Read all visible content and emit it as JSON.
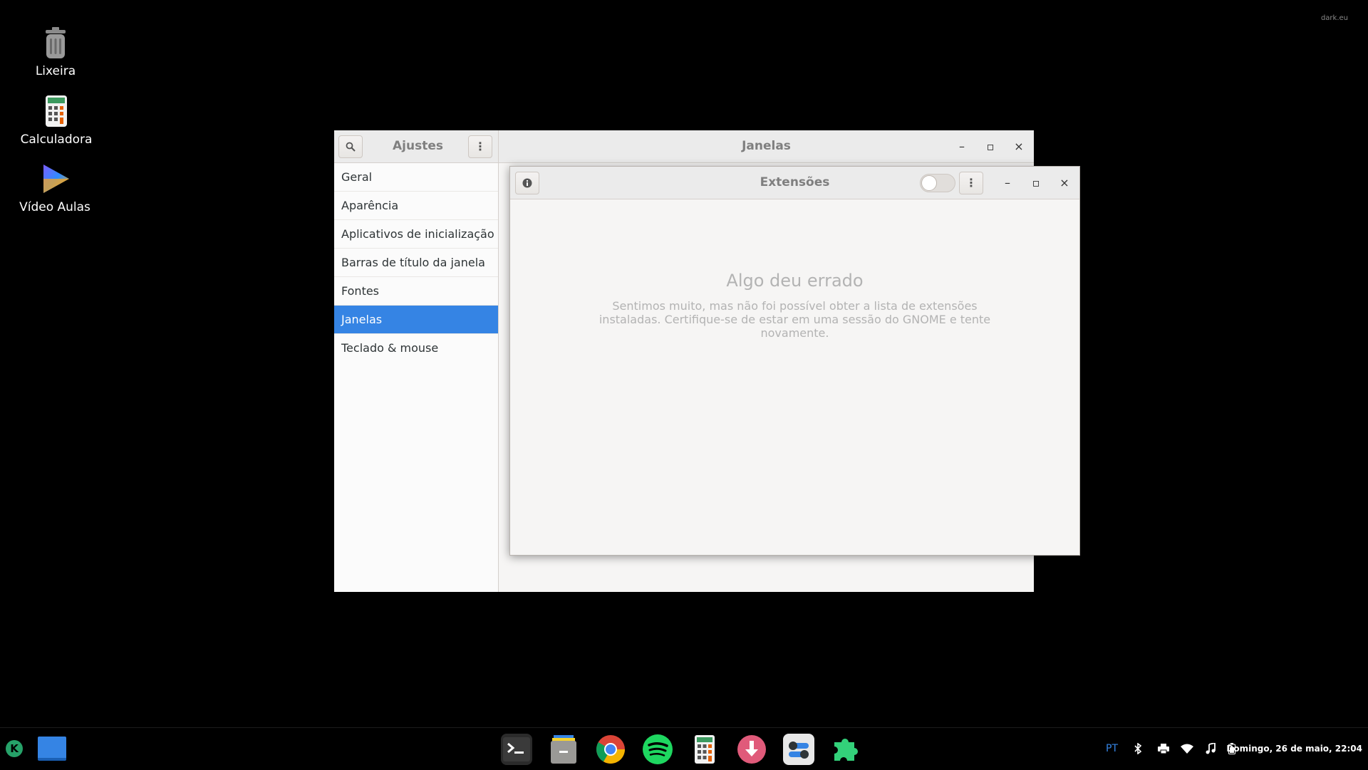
{
  "desktop": {
    "icons": [
      {
        "label": "Lixeira",
        "icon": "trash-icon"
      },
      {
        "label": "Calculadora",
        "icon": "calculator-icon"
      },
      {
        "label": "Vídeo Aulas",
        "icon": "video-play-icon"
      }
    ],
    "watermark": "dark.eu"
  },
  "tweaks_window": {
    "sidebar_title": "Ajustes",
    "title": "Janelas",
    "sidebar_items": [
      {
        "label": "Geral"
      },
      {
        "label": "Aparência"
      },
      {
        "label": "Aplicativos de inicialização"
      },
      {
        "label": "Barras de título da janela"
      },
      {
        "label": "Fontes"
      },
      {
        "label": "Janelas"
      },
      {
        "label": "Teclado & mouse"
      }
    ],
    "selected_item": "Janelas",
    "controls": {
      "minimize": "–",
      "maximize": "▫",
      "close": "×"
    }
  },
  "extensions_window": {
    "title": "Extensões",
    "toggle_on": false,
    "error_title": "Algo deu errado",
    "error_message": "Sentimos muito, mas não foi possível obter a lista de extensões instaladas. Certifique-se de estar em uma sessão do GNOME e tente novamente."
  },
  "taskbar": {
    "apps": [
      {
        "name": "terminal",
        "icon": "terminal-icon"
      },
      {
        "name": "files",
        "icon": "files-icon"
      },
      {
        "name": "chrome",
        "icon": "chrome-icon"
      },
      {
        "name": "spotify",
        "icon": "spotify-icon"
      },
      {
        "name": "calculator",
        "icon": "calculator-icon"
      },
      {
        "name": "downloader",
        "icon": "download-icon"
      },
      {
        "name": "tweaks",
        "icon": "tweaks-icon"
      },
      {
        "name": "extensions",
        "icon": "puzzle-icon"
      }
    ],
    "language": "PT",
    "clock": "Domingo, 26 de maio, 22:04"
  },
  "colors": {
    "accent": "#3584e4",
    "spotify": "#1ed760",
    "puzzle": "#33d17a",
    "download": "#e05a7a"
  }
}
